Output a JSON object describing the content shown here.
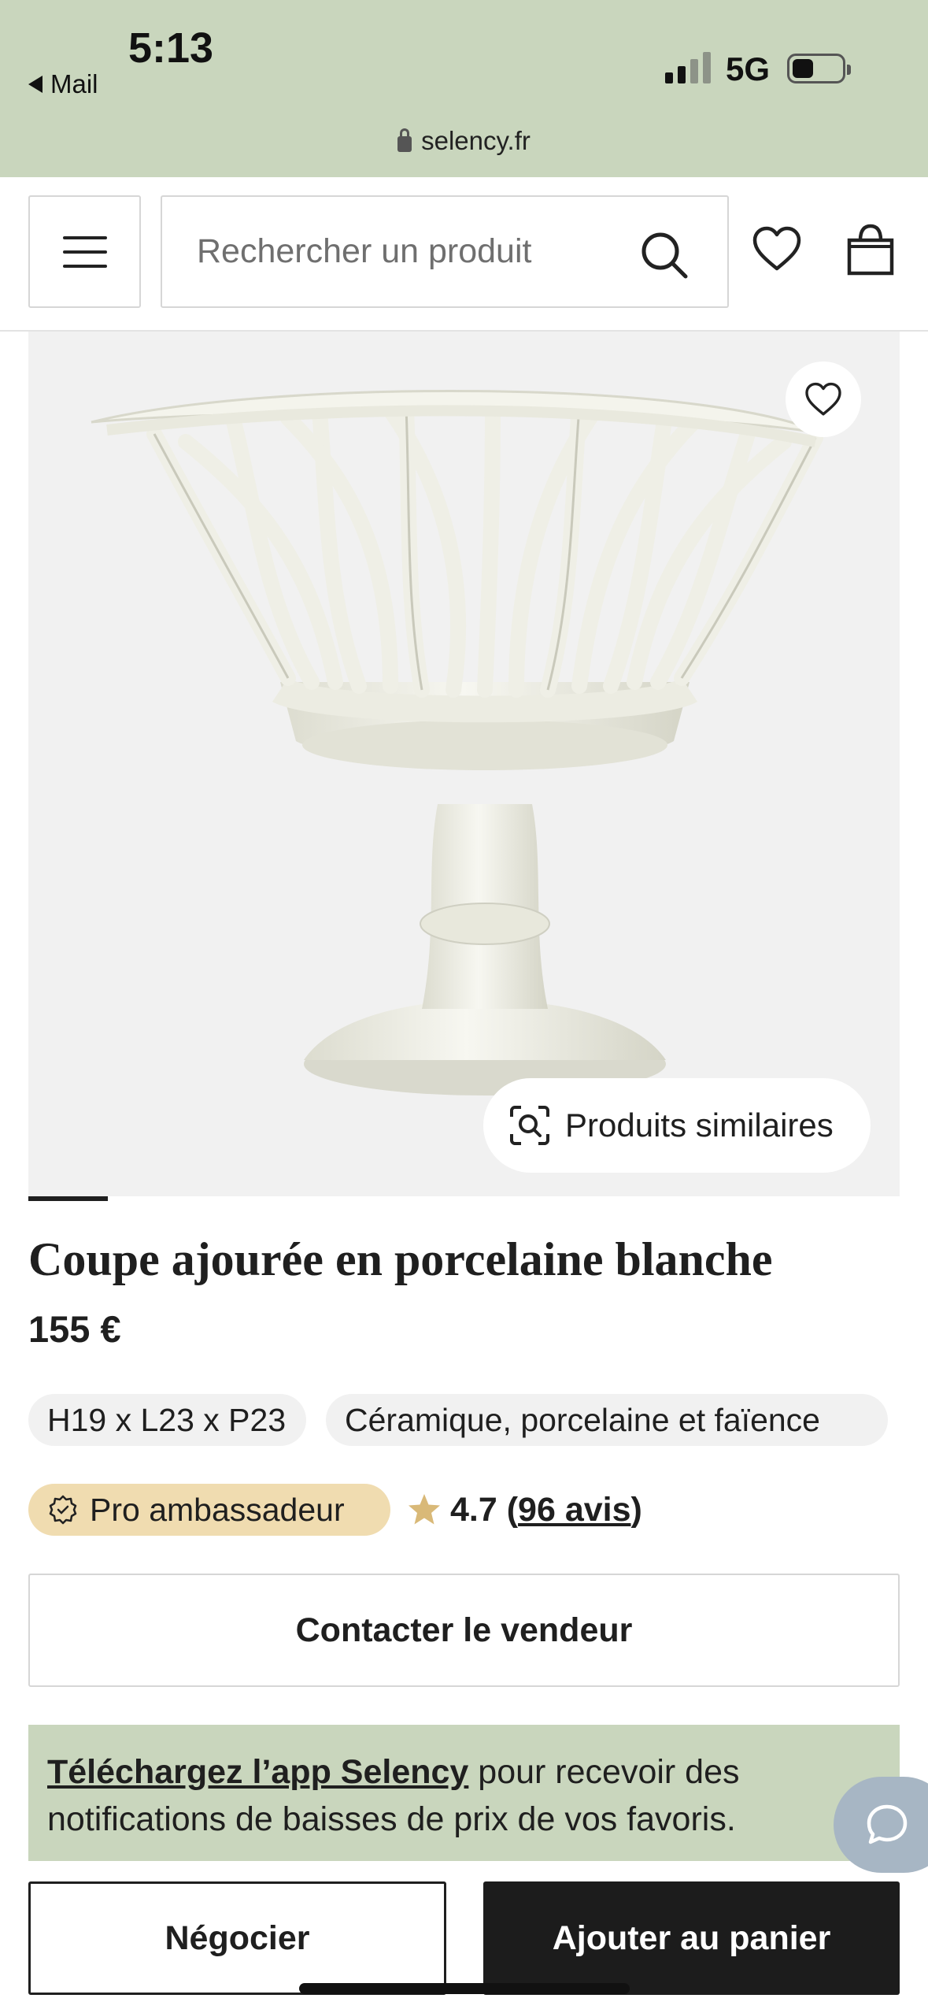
{
  "status_bar": {
    "back_app": "Mail",
    "time": "5:13",
    "network": "5G",
    "signal_bars": 2,
    "battery_level": 0.3
  },
  "browser": {
    "url": "selency.fr"
  },
  "header": {
    "search_placeholder": "Rechercher un produit",
    "icons": [
      "menu-icon",
      "search-icon",
      "heart-icon",
      "shopping-bag-icon"
    ]
  },
  "product": {
    "image_description_alt": "Coupe ajourée en porcelaine blanche",
    "similar_button_label": "Produits similaires",
    "title": "Coupe ajourée en porcelaine blanche",
    "price": "155 €",
    "tags": {
      "dimensions": "H19 x L23 x P23",
      "category": "Céramique, porcelaine et faïence"
    },
    "seller_badge": "Pro ambassadeur",
    "rating": {
      "prefix": "4.7 (",
      "reviews": "96 avis",
      "suffix": ")"
    },
    "contact_label": "Contacter le vendeur"
  },
  "app_banner": {
    "link_text": "Téléchargez l’app Selency",
    "rest_text": " pour recevoir des notifications de baisses de prix de vos favoris."
  },
  "actions": {
    "negotiate_label": "Négocier",
    "add_to_cart_label": "Ajouter au panier"
  },
  "colors": {
    "brand_green": "#c9d6bd",
    "badge_gold": "#f0dcb0",
    "star": "#d9b978",
    "chat_bubble": "#a7b6c4",
    "primary_dark": "#1c1c1c"
  }
}
